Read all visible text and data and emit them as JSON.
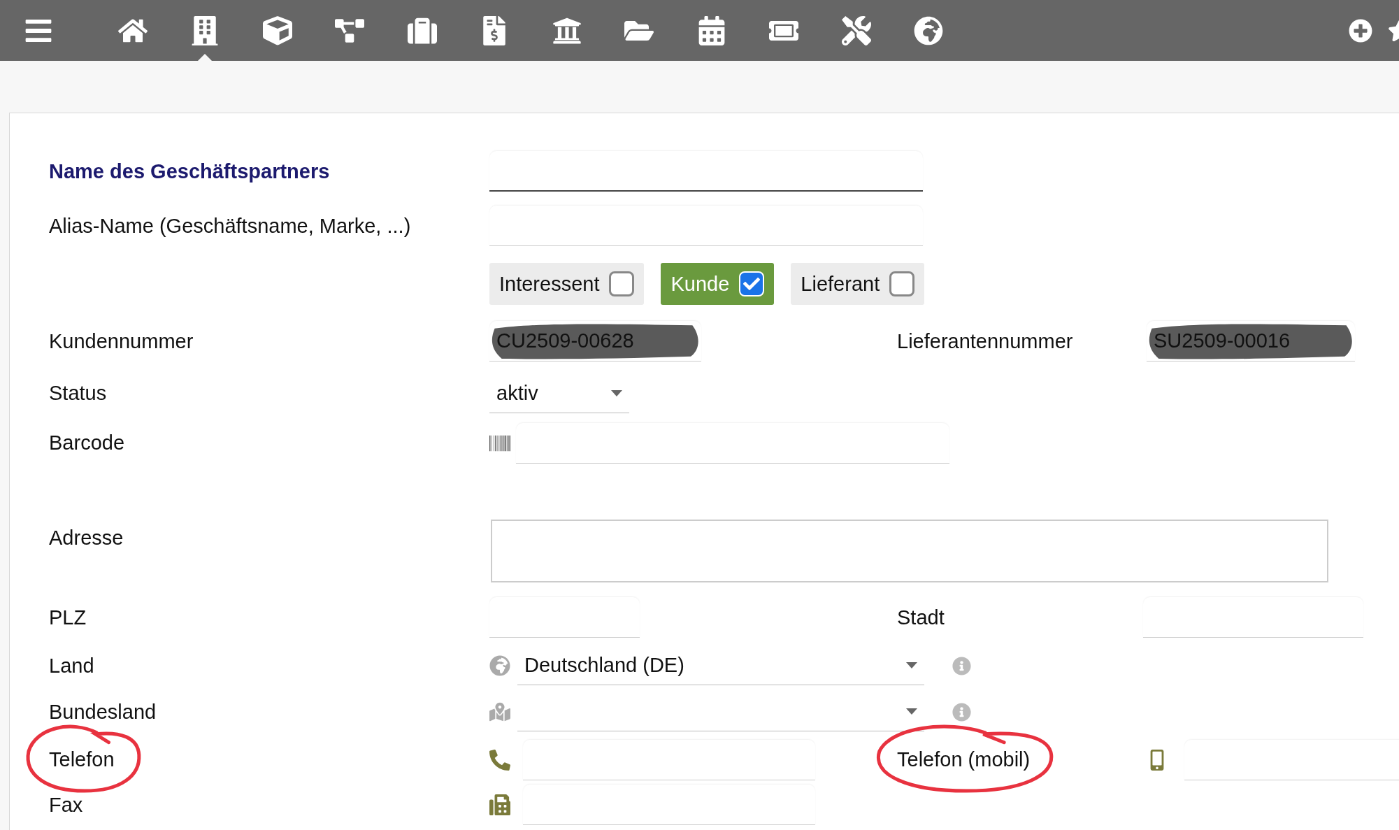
{
  "toolbar": {
    "items": [
      {
        "kind": "menu",
        "selected": false
      },
      {
        "kind": "home",
        "selected": false
      },
      {
        "kind": "company",
        "selected": true
      },
      {
        "kind": "product",
        "selected": false
      },
      {
        "kind": "project",
        "selected": false
      },
      {
        "kind": "commercial",
        "selected": false
      },
      {
        "kind": "billing",
        "selected": false
      },
      {
        "kind": "bank",
        "selected": false
      },
      {
        "kind": "documents",
        "selected": false
      },
      {
        "kind": "agenda",
        "selected": false
      },
      {
        "kind": "ticket",
        "selected": false
      },
      {
        "kind": "tools",
        "selected": false
      },
      {
        "kind": "website",
        "selected": false
      }
    ],
    "right": [
      {
        "kind": "add"
      },
      {
        "kind": "bookmark"
      }
    ]
  },
  "form": {
    "rows": [
      {
        "kind": "text",
        "label": "Name des Geschäftspartners",
        "required": true,
        "circled": false
      },
      {
        "kind": "text",
        "label": "Alias-Name (Geschäftsname, Marke, ...)",
        "required": false,
        "circled": false
      },
      {
        "kind": "types",
        "options": [
          {
            "label": "Interessent",
            "checked": false
          },
          {
            "label": "Kunde",
            "checked": true
          },
          {
            "label": "Lieferant",
            "checked": false
          }
        ]
      },
      {
        "kind": "code",
        "label": "Kundennummer",
        "required": false,
        "circled": false,
        "value": "CU2509-00628",
        "redacted": true,
        "right": {
          "label": "Lieferantennummer",
          "circled": false,
          "value": "SU2509-00016",
          "redacted": true
        }
      },
      {
        "kind": "select",
        "label": "Status",
        "required": false,
        "circled": false,
        "value": "aktiv"
      },
      {
        "kind": "barcode",
        "label": "Barcode",
        "required": false,
        "circled": false
      },
      {
        "kind": "textarea",
        "label": "Adresse",
        "required": false,
        "circled": false
      },
      {
        "kind": "text-pair",
        "label": "PLZ",
        "required": false,
        "circled": false,
        "right": {
          "label": "Stadt",
          "circled": false
        }
      },
      {
        "kind": "country",
        "label": "Land",
        "required": false,
        "circled": false,
        "value": "Deutschland (DE)"
      },
      {
        "kind": "region",
        "label": "Bundesland",
        "required": false,
        "circled": false
      },
      {
        "kind": "phone",
        "label": "Telefon",
        "required": false,
        "circled": true,
        "right": {
          "label": "Telefon (mobil)",
          "circled": true
        }
      },
      {
        "kind": "fax",
        "label": "Fax",
        "required": false,
        "circled": false
      }
    ]
  }
}
